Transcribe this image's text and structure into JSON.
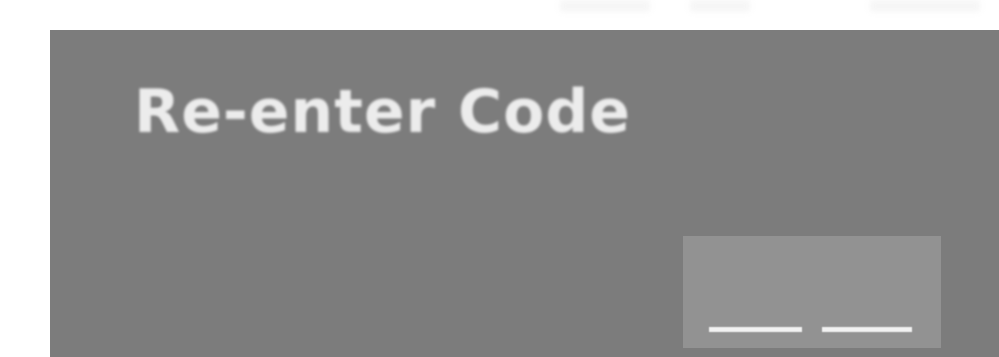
{
  "dialog": {
    "title": "Re-enter Code"
  },
  "code_entry": {
    "digits": [
      "",
      ""
    ]
  },
  "colors": {
    "panel": "#7c7c7c",
    "code_box": "#929292",
    "text": "#ececec",
    "underline": "#f2f2f2"
  }
}
